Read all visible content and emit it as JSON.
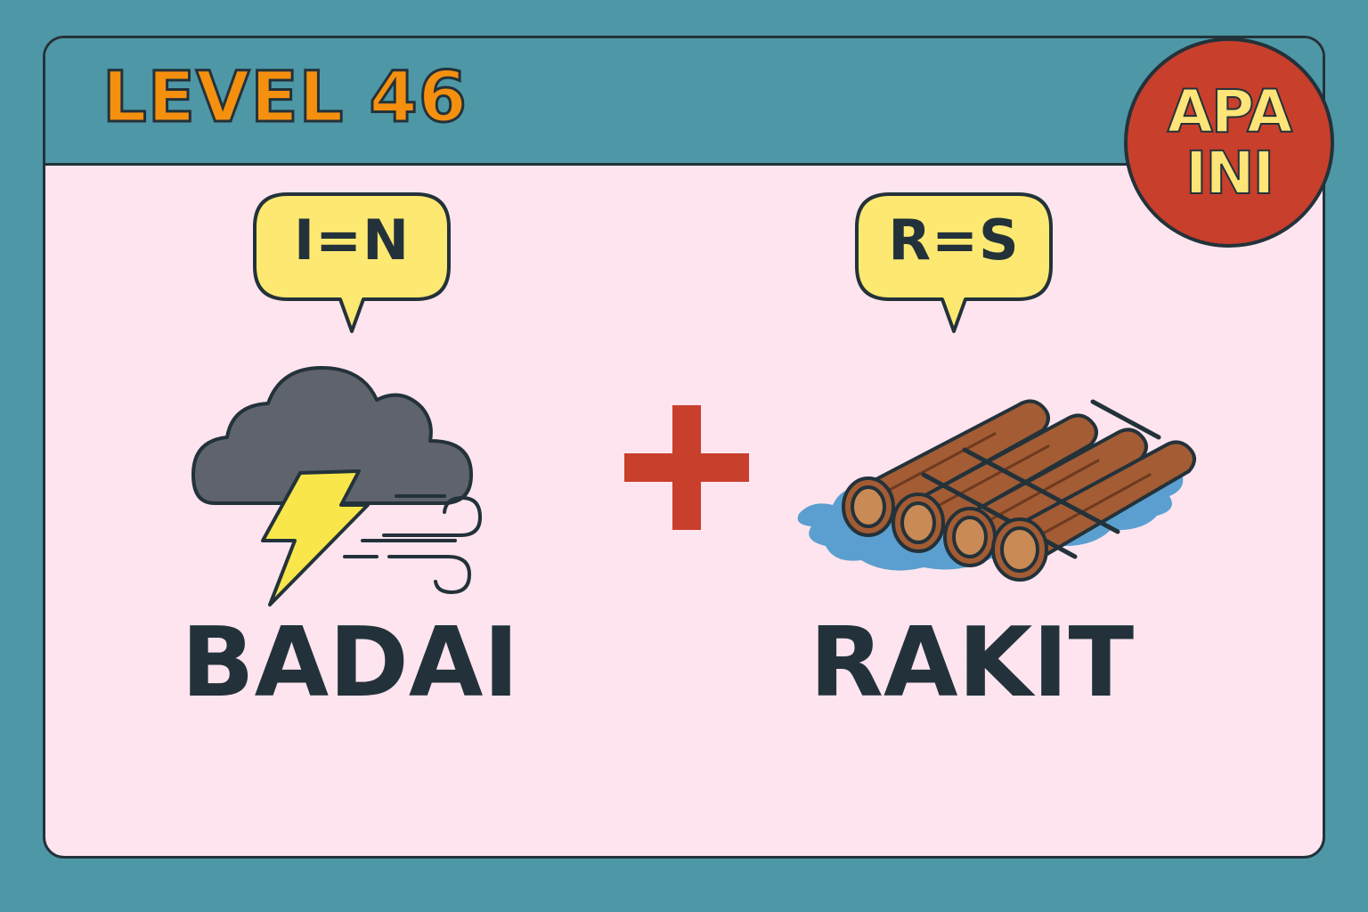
{
  "level": {
    "title": "LEVEL 46"
  },
  "badge": {
    "line1": "APA",
    "line2": "INI"
  },
  "clues": [
    {
      "hint": "I=N",
      "word": "BADAI",
      "icon": "storm-cloud-icon"
    },
    {
      "hint": "R=S",
      "word": "RAKIT",
      "icon": "log-raft-icon"
    }
  ],
  "operator": {
    "symbol": "plus-icon"
  },
  "colors": {
    "background": "#4e97a6",
    "card": "#fde4ee",
    "level_title": "#f5900f",
    "badge": "#c83f2c",
    "badge_text": "#ffe478",
    "bubble": "#fde872",
    "outline": "#23323a",
    "plus": "#c83f2c"
  }
}
